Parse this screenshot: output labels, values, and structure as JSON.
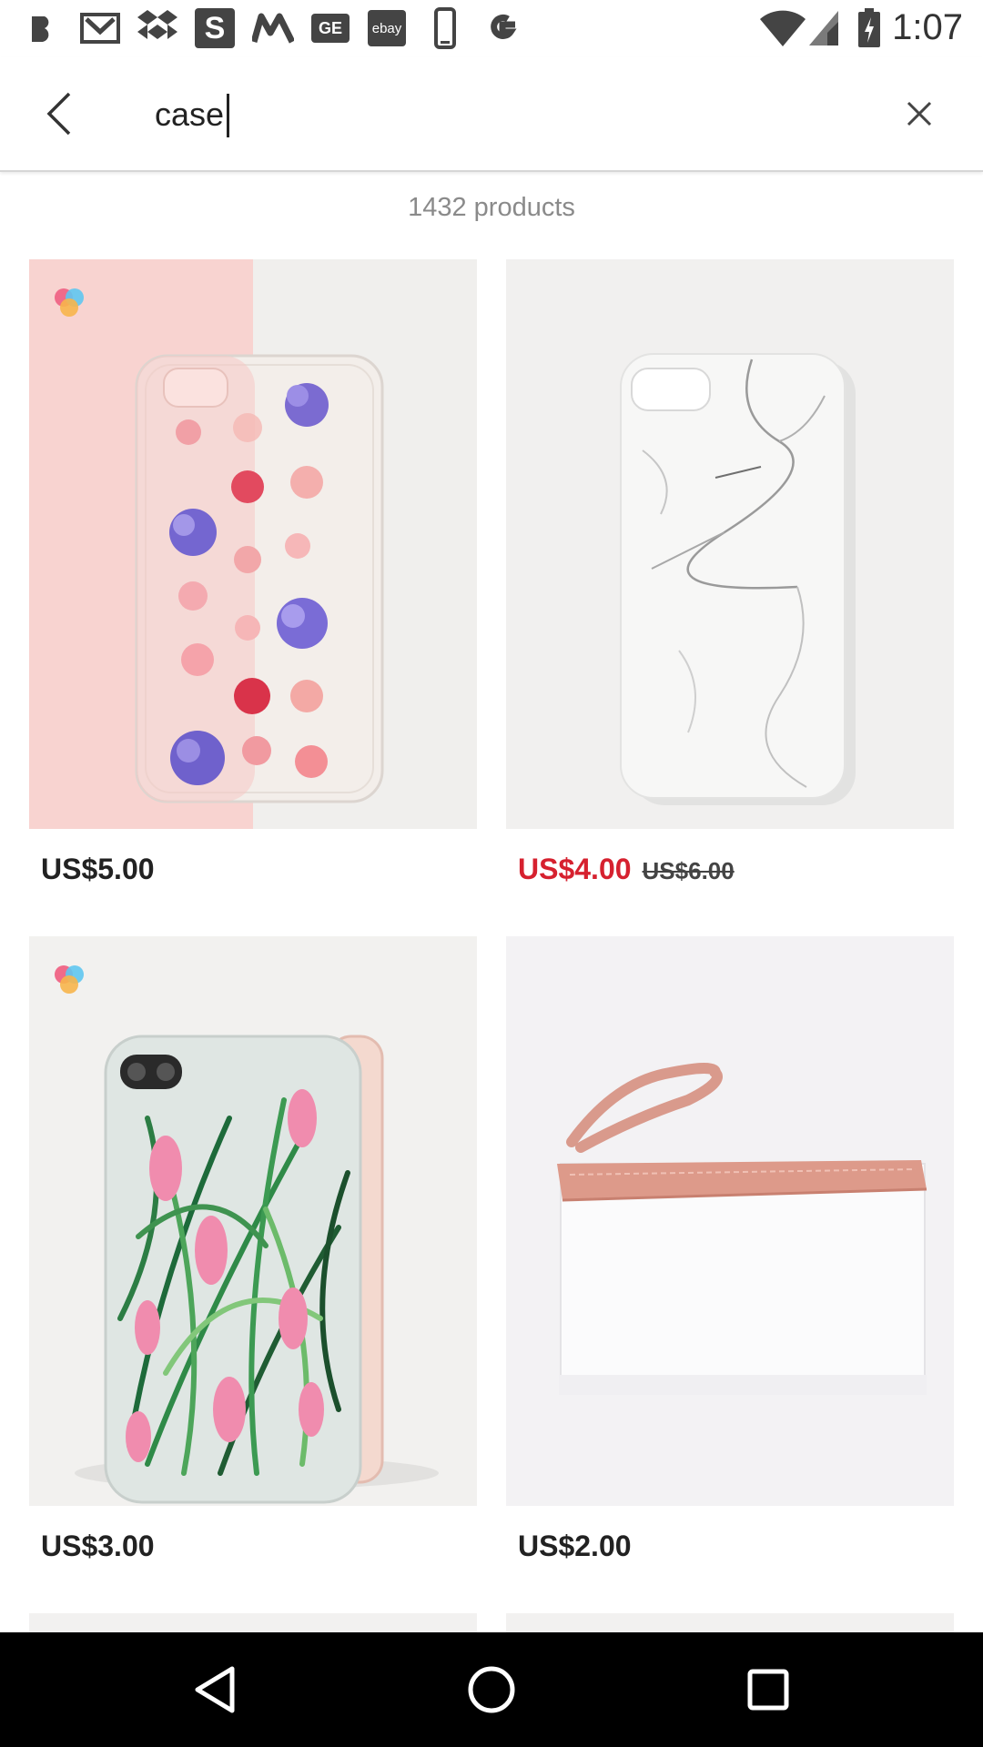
{
  "status_bar": {
    "time": "1:07",
    "notification_icons": [
      "b-icon",
      "gmail-icon",
      "dropbox-icon",
      "s-icon",
      "m-icon",
      "ge-icon",
      "ebay-icon",
      "phone-icon",
      "google-icon"
    ],
    "ebay_label": "ebay",
    "ge_label": "GE",
    "s_label": "S"
  },
  "search": {
    "query": "case",
    "back_icon": "chevron-left-icon",
    "clear_icon": "close-icon"
  },
  "results": {
    "count_text": "1432 products"
  },
  "products": [
    {
      "price": "US$5.00",
      "badge": true
    },
    {
      "price": "US$4.00",
      "original_price": "US$6.00",
      "on_sale": true
    },
    {
      "price": "US$3.00",
      "badge": true
    },
    {
      "price": "US$2.00"
    }
  ],
  "colors": {
    "sale_price": "#d6212f",
    "text": "#222222",
    "muted": "#8a8a8a"
  },
  "nav": {
    "back": "nav-back-icon",
    "home": "nav-home-icon",
    "recents": "nav-recents-icon"
  }
}
